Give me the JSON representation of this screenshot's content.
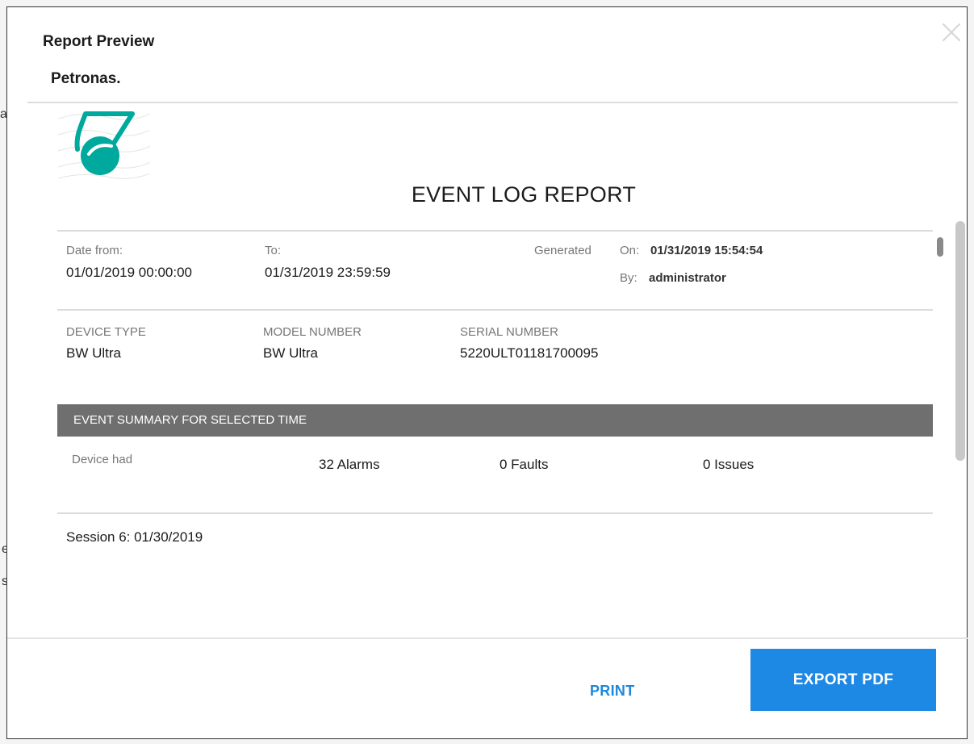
{
  "modal": {
    "title": "Report Preview",
    "organization": "Petronas."
  },
  "report": {
    "title": "EVENT LOG REPORT",
    "date_from_label": "Date from:",
    "date_from_value": "01/01/2019 00:00:00",
    "to_label": "To:",
    "to_value": "01/31/2019 23:59:59",
    "generated_label": "Generated",
    "generated_on_label": "On:",
    "generated_on_value": "01/31/2019 15:54:54",
    "generated_by_label": "By:",
    "generated_by_value": "administrator",
    "device_type_label": "DEVICE TYPE",
    "device_type_value": "BW Ultra",
    "model_number_label": "MODEL NUMBER",
    "model_number_value": "BW Ultra",
    "serial_number_label": "SERIAL NUMBER",
    "serial_number_value": "5220ULT01181700095",
    "summary_header": "EVENT SUMMARY FOR SELECTED TIME",
    "device_had_label": "Device had",
    "alarms": "32 Alarms",
    "faults": "0 Faults",
    "issues": "0 Issues",
    "session_line": "Session 6: 01/30/2019"
  },
  "footer": {
    "print_label": "PRINT",
    "export_label": "EXPORT PDF"
  },
  "colors": {
    "accent": "#1e88e5",
    "logo_teal": "#00a99d",
    "summary_bar": "#6f6f6f"
  },
  "icons": {
    "close": "close-icon",
    "logo": "petronas-logo"
  }
}
